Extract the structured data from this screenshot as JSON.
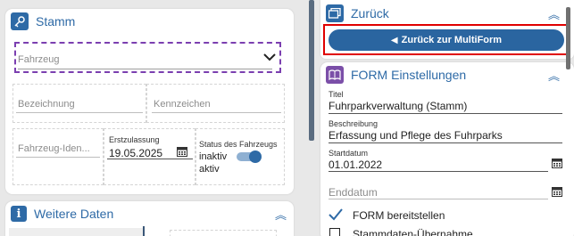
{
  "stamm": {
    "title": "Stamm",
    "fahrzeug_placeholder": "Fahrzeug",
    "bezeichnung_placeholder": "Bezeichnung",
    "kennzeichen_placeholder": "Kennzeichen",
    "fahrzeug_ident_placeholder": "Fahrzeug-Iden...",
    "erstzulassung_label": "Erstzulassung",
    "erstzulassung_value": "19.05.2025",
    "status_label": "Status des Fahrzeugs",
    "status_inactive": "inaktiv",
    "status_active": "aktiv",
    "status_toggle_on": true
  },
  "weitere": {
    "title": "Weitere Daten"
  },
  "zurueck": {
    "title": "Zurück",
    "button_label": "Zurück zur MultiForm"
  },
  "form_einstellungen": {
    "title": "FORM Einstellungen",
    "titel_label": "Titel",
    "titel_value": "Fuhrparkverwaltung (Stamm)",
    "beschreibung_label": "Beschreibung",
    "beschreibung_value": "Erfassung und Pflege des Fuhrparks",
    "startdatum_label": "Startdatum",
    "startdatum_value": "01.01.2022",
    "enddatum_placeholder": "Enddatum",
    "bereitstellen_label": "FORM bereitstellen",
    "bereitstellen_checked": true,
    "stammdaten_label": "Stammdaten-Übernahme",
    "stammdaten_checked": false
  },
  "colors": {
    "accent": "#2e6aa6",
    "button": "#2a65a0",
    "highlight": "#e00000",
    "focus_dash": "#7b3fb0",
    "form_icon": "#7b4fa8"
  },
  "icons": {
    "stamm": "key-icon",
    "weitere": "info-icon",
    "zurueck": "window-icon",
    "form": "book-icon",
    "collapse": "double-chevron-up-icon",
    "calendar": "calendar-icon"
  }
}
